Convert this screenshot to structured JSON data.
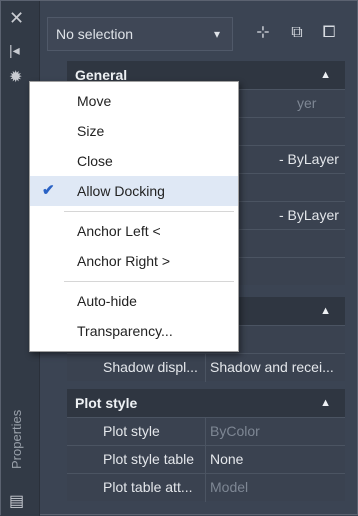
{
  "title_strip": {
    "label": "Properties"
  },
  "topbar": {
    "selection_value": "No selection",
    "dropdown_arrow": "▾",
    "buttons": [
      {
        "icon": "select-objects-icon",
        "glyph": "⊹"
      },
      {
        "icon": "quick-select-icon",
        "glyph": "⧉"
      },
      {
        "icon": "toggle-pickadd-icon",
        "glyph": "⧠"
      }
    ]
  },
  "sections": {
    "general": {
      "header": "General",
      "collapse": "▲"
    },
    "hidden": {
      "collapse": "▲"
    },
    "plot_style": {
      "header": "Plot style",
      "collapse": "▲"
    }
  },
  "general_rows_visible_values": [
    "yer",
    "- ByLayer",
    "- ByLayer"
  ],
  "shadow_row": {
    "name": "Shadow displ...",
    "value": "Shadow and recei..."
  },
  "plot_rows": [
    {
      "name": "Plot style",
      "value": "ByColor",
      "muted": true
    },
    {
      "name": "Plot style table",
      "value": "None",
      "muted": false
    },
    {
      "name": "Plot table att...",
      "value": "Model",
      "muted": true
    }
  ],
  "context_menu": {
    "items": [
      {
        "label": "Move",
        "checked": false
      },
      {
        "label": "Size",
        "checked": false
      },
      {
        "label": "Close",
        "checked": false
      },
      {
        "label": "Allow Docking",
        "checked": true
      },
      {
        "label": "Anchor Left <",
        "checked": false
      },
      {
        "label": "Anchor Right >",
        "checked": false
      },
      {
        "label": "Auto-hide",
        "checked": false
      },
      {
        "label": "Transparency...",
        "checked": false
      }
    ],
    "check_glyph": "✔"
  },
  "colors": {
    "accent": "#2a62c5",
    "panel_bg": "#3b4453",
    "header_bg": "#2f3641"
  }
}
